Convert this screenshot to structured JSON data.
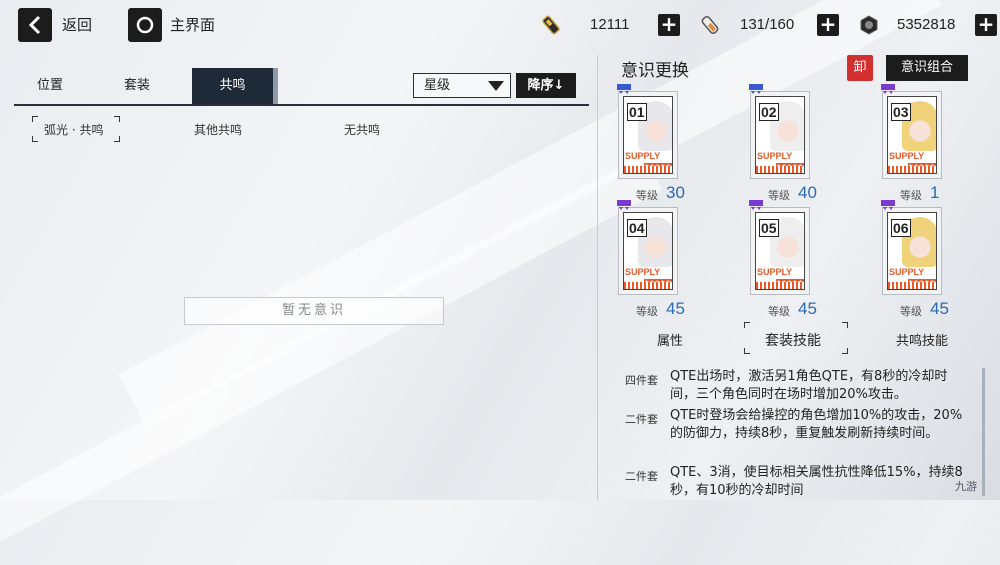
{
  "topbar": {
    "back_label": "返回",
    "home_label": "主界面",
    "resources": [
      {
        "icon": "battery-icon",
        "value": "12111"
      },
      {
        "icon": "stamina-icon",
        "value": "131/160"
      },
      {
        "icon": "coin-icon",
        "value": "5352818"
      }
    ]
  },
  "left": {
    "tabs": [
      "位置",
      "套装",
      "共鸣"
    ],
    "active_tab": "共鸣",
    "sort_value": "星级",
    "sort_order": "降序↓",
    "filters": [
      "弧光 · 共鸣",
      "其他共鸣",
      "无共鸣"
    ],
    "empty_text": "暂无意识"
  },
  "right": {
    "title": "意识更换",
    "unload_label": "卸",
    "combo_label": "意识组合",
    "level_label": "等级",
    "cards": [
      {
        "num": "01",
        "level": "30",
        "tier": "blue",
        "hair": "#e8e8ec"
      },
      {
        "num": "02",
        "level": "40",
        "tier": "blue",
        "hair": "#eeeeee"
      },
      {
        "num": "03",
        "level": "1",
        "tier": "purple",
        "hair": "#f0d27a"
      },
      {
        "num": "04",
        "level": "45",
        "tier": "purple",
        "hair": "#e8e8ec"
      },
      {
        "num": "05",
        "level": "45",
        "tier": "purple",
        "hair": "#eeeeee"
      },
      {
        "num": "06",
        "level": "45",
        "tier": "purple",
        "hair": "#f0d27a"
      }
    ],
    "supply_text": "SUPPLY",
    "tabs": [
      "属性",
      "套装技能",
      "共鸣技能"
    ],
    "active_tab": "套装技能",
    "descriptions": [
      {
        "tag": "四件套",
        "text": "QTE出场时，激活另1角色QTE，有8秒的冷却时间，三个角色同时在场时增加20%攻击。"
      },
      {
        "tag": "二件套",
        "text": "QTE时登场会给操控的角色增加10%的攻击，20%的防御力，持续8秒，重复触发刷新持续时间。"
      },
      {
        "tag": "二件套",
        "text": "QTE、3消，使目标相关属性抗性降低15%，持续8秒，有10秒的冷却时间"
      }
    ],
    "watermark": "九游"
  },
  "colors": {
    "accent_blue": "#2a6bb8",
    "danger_red": "#d32f2f",
    "supply_orange": "#e65a2a",
    "tier_blue": "#3a5bd0",
    "tier_purple": "#7a3ad0"
  }
}
